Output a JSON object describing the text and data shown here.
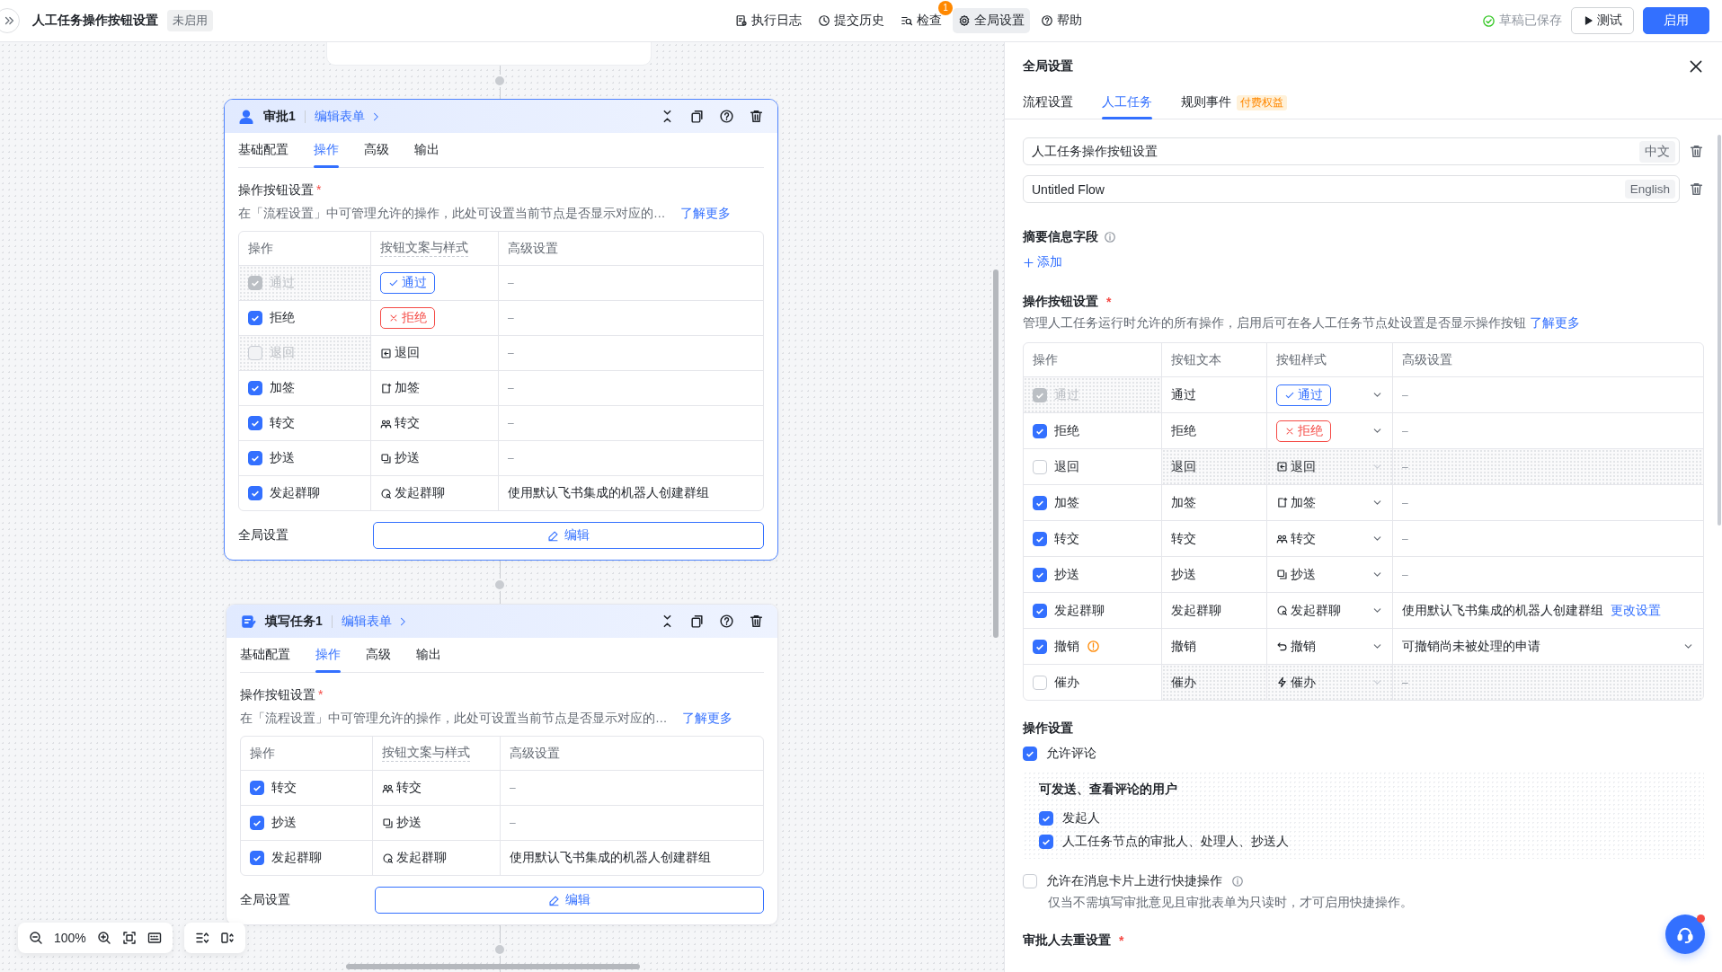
{
  "topbar": {
    "title": "人工任务操作按钮设置",
    "status": "未启用",
    "actions": [
      {
        "kind": "log",
        "label": "执行日志",
        "selected": false
      },
      {
        "kind": "history",
        "label": "提交历史",
        "selected": false
      },
      {
        "kind": "check",
        "label": "检查",
        "selected": false,
        "badge": "1"
      },
      {
        "kind": "settings",
        "label": "全局设置",
        "selected": true
      },
      {
        "kind": "help",
        "label": "帮助",
        "selected": false
      }
    ],
    "save_status": "草稿已保存",
    "test_button": "测试",
    "enable_button": "启用"
  },
  "canvas": {
    "zoom": "100%",
    "nodes": [
      {
        "kind": "approval",
        "selected": true,
        "title": "审批1",
        "edit_form": "编辑表单",
        "tabs": [
          {
            "label": "基础配置",
            "selected": false
          },
          {
            "label": "操作",
            "selected": true
          },
          {
            "label": "高级",
            "selected": false
          },
          {
            "label": "输出",
            "selected": false
          }
        ],
        "section_title": "操作按钮设置",
        "required_mark": "*",
        "description": "在「流程设置」中可管理允许的操作，此处可设置当前节点是否显示对应的…",
        "learn_more": "了解更多",
        "columns": [
          "操作",
          "按钮文案与样式",
          "高级设置"
        ],
        "rows": [
          {
            "kind": "approve",
            "label": "通过",
            "checked": true,
            "disabled": true,
            "button": "通过",
            "empty_marker": "–"
          },
          {
            "kind": "reject",
            "label": "拒绝",
            "checked": true,
            "disabled": false,
            "button": "拒绝",
            "empty_marker": "–"
          },
          {
            "kind": "return",
            "label": "退回",
            "checked": false,
            "disabled": true,
            "button": "退回",
            "empty_marker": "–"
          },
          {
            "kind": "add_sign",
            "label": "加签",
            "checked": true,
            "disabled": false,
            "button": "加签",
            "empty_marker": "–"
          },
          {
            "kind": "transfer",
            "label": "转交",
            "checked": true,
            "disabled": false,
            "button": "转交",
            "empty_marker": "–"
          },
          {
            "kind": "cc",
            "label": "抄送",
            "checked": true,
            "disabled": false,
            "button": "抄送",
            "empty_marker": "–"
          },
          {
            "kind": "group_chat",
            "label": "发起群聊",
            "checked": true,
            "disabled": false,
            "button": "发起群聊",
            "advanced": "使用默认飞书集成的机器人创建群组"
          }
        ],
        "global_label": "全局设置",
        "edit_button": "编辑"
      },
      {
        "kind": "fill",
        "selected": false,
        "title": "填写任务1",
        "edit_form": "编辑表单",
        "tabs": [
          {
            "label": "基础配置",
            "selected": false
          },
          {
            "label": "操作",
            "selected": true
          },
          {
            "label": "高级",
            "selected": false
          },
          {
            "label": "输出",
            "selected": false
          }
        ],
        "section_title": "操作按钮设置",
        "required_mark": "*",
        "description": "在「流程设置」中可管理允许的操作，此处可设置当前节点是否显示对应的…",
        "learn_more": "了解更多",
        "columns": [
          "操作",
          "按钮文案与样式",
          "高级设置"
        ],
        "rows": [
          {
            "kind": "transfer",
            "label": "转交",
            "checked": true,
            "disabled": false,
            "button": "转交",
            "empty_marker": "–"
          },
          {
            "kind": "cc",
            "label": "抄送",
            "checked": true,
            "disabled": false,
            "button": "抄送",
            "empty_marker": "–"
          },
          {
            "kind": "group_chat",
            "label": "发起群聊",
            "checked": true,
            "disabled": false,
            "button": "发起群聊",
            "advanced": "使用默认飞书集成的机器人创建群组"
          }
        ],
        "global_label": "全局设置",
        "edit_button": "编辑"
      }
    ]
  },
  "panel": {
    "title": "全局设置",
    "tabs": [
      {
        "label": "流程设置",
        "selected": false
      },
      {
        "label": "人工任务",
        "selected": true
      },
      {
        "label": "规则事件",
        "selected": false,
        "badge": "付费权益"
      }
    ],
    "name_fields": [
      {
        "value": "人工任务操作按钮设置",
        "lang": "中文"
      },
      {
        "value": "Untitled Flow",
        "lang": "English"
      }
    ],
    "summary_title": "摘要信息字段",
    "add_link": "添加",
    "buttons_title": "操作按钮设置",
    "required_mark": "*",
    "buttons_description": "管理人工任务运行时允许的所有操作，启用后可在各人工任务节点处设置是否显示操作按钮",
    "learn_more": "了解更多",
    "columns": [
      "操作",
      "按钮文本",
      "按钮样式",
      "高级设置"
    ],
    "rows": [
      {
        "kind": "approve",
        "label": "通过",
        "checked": true,
        "disabled": true,
        "warning": false,
        "text": "通过",
        "style": "通过",
        "empty_marker": "–"
      },
      {
        "kind": "reject",
        "label": "拒绝",
        "checked": true,
        "disabled": false,
        "warning": false,
        "text": "拒绝",
        "style": "拒绝",
        "empty_marker": "–"
      },
      {
        "kind": "return",
        "label": "退回",
        "checked": false,
        "disabled": false,
        "warning": false,
        "text": "退回",
        "style": "退回",
        "empty_marker": "–"
      },
      {
        "kind": "add_sign",
        "label": "加签",
        "checked": true,
        "disabled": false,
        "warning": false,
        "text": "加签",
        "style": "加签",
        "empty_marker": "–"
      },
      {
        "kind": "transfer",
        "label": "转交",
        "checked": true,
        "disabled": false,
        "warning": false,
        "text": "转交",
        "style": "转交",
        "empty_marker": "–"
      },
      {
        "kind": "cc",
        "label": "抄送",
        "checked": true,
        "disabled": false,
        "warning": false,
        "text": "抄送",
        "style": "抄送",
        "empty_marker": "–"
      },
      {
        "kind": "group_chat",
        "label": "发起群聊",
        "checked": true,
        "disabled": false,
        "warning": false,
        "text": "发起群聊",
        "style": "发起群聊",
        "advanced": "使用默认飞书集成的机器人创建群组",
        "advanced_link": "更改设置"
      },
      {
        "kind": "revoke",
        "label": "撤销",
        "checked": true,
        "disabled": false,
        "warning": true,
        "text": "撤销",
        "style": "撤销",
        "advanced": "可撤销尚未被处理的申请",
        "advanced_dropdown": true
      },
      {
        "kind": "urge",
        "label": "催办",
        "checked": false,
        "disabled": false,
        "warning": false,
        "text": "催办",
        "style": "催办",
        "empty_marker": "–"
      }
    ],
    "op_title": "操作设置",
    "allow_comment": {
      "label": "允许评论",
      "checked": true
    },
    "comment_users": {
      "title": "可发送、查看评论的用户",
      "options": [
        {
          "label": "发起人",
          "checked": true
        },
        {
          "label": "人工任务节点的审批人、处理人、抄送人",
          "checked": true
        }
      ]
    },
    "quick_action": {
      "label": "允许在消息卡片上进行快捷操作",
      "checked": false,
      "hint": "仅当不需填写审批意见且审批表单为只读时，才可启用快捷操作。"
    },
    "dedupe_title": "审批人去重设置"
  }
}
